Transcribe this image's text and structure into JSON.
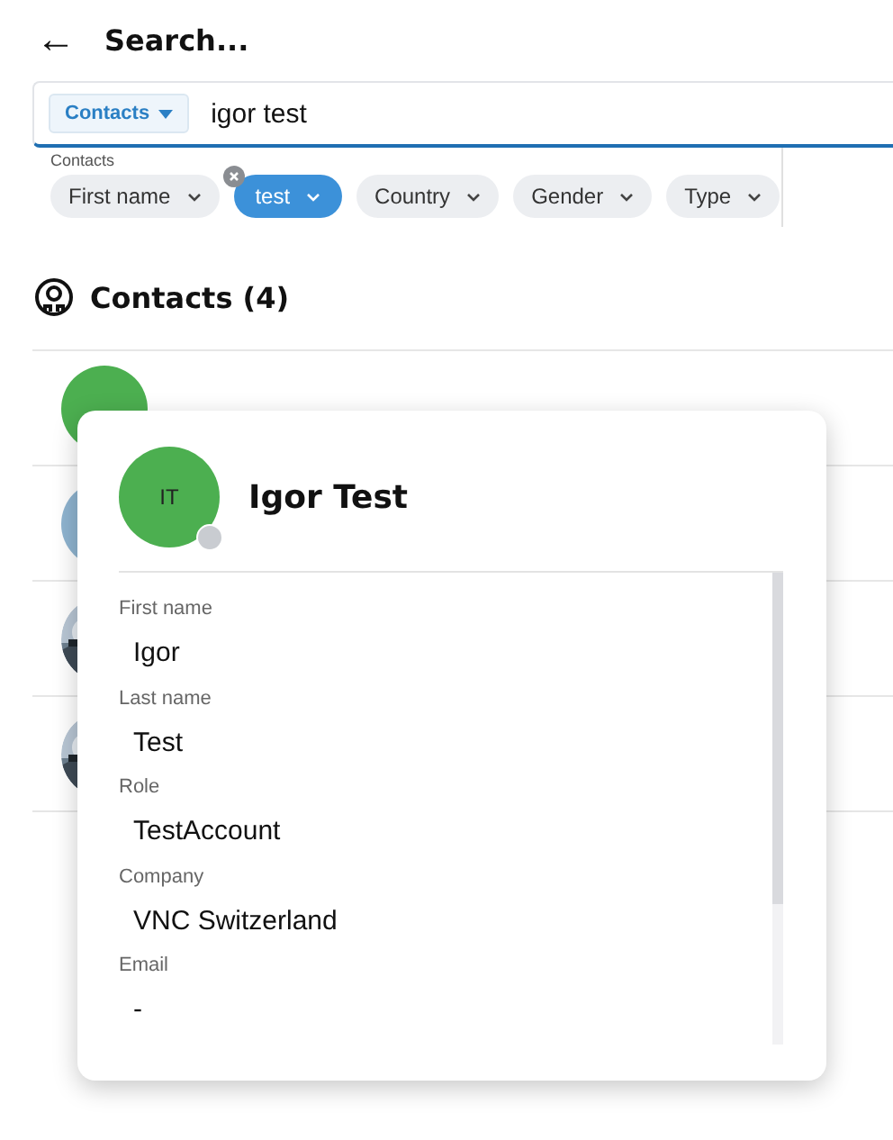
{
  "header": {
    "back": "←",
    "title": "Search..."
  },
  "search": {
    "scope": "Contacts",
    "value": "igor test"
  },
  "filters": {
    "label": "Contacts",
    "chips": [
      {
        "label": "First name",
        "selected": false,
        "removable": false
      },
      {
        "label": "test",
        "selected": true,
        "removable": true
      },
      {
        "label": "Country",
        "selected": false,
        "removable": false
      },
      {
        "label": "Gender",
        "selected": false,
        "removable": false
      },
      {
        "label": "Type",
        "selected": false,
        "removable": false
      }
    ]
  },
  "section": {
    "title": "Contacts (4)"
  },
  "rows": [
    {
      "kind": "plain",
      "color": "#4caf50"
    },
    {
      "kind": "plain",
      "color": "#8fb4d0"
    },
    {
      "kind": "picture"
    },
    {
      "kind": "picture"
    }
  ],
  "popup": {
    "initials": "IT",
    "name": "Igor Test",
    "fields": [
      {
        "label": "First name",
        "value": "Igor"
      },
      {
        "label": "Last name",
        "value": "Test"
      },
      {
        "label": "Role",
        "value": "TestAccount"
      },
      {
        "label": "Company",
        "value": "VNC Switzerland"
      },
      {
        "label": "Email",
        "value": "-"
      }
    ]
  }
}
